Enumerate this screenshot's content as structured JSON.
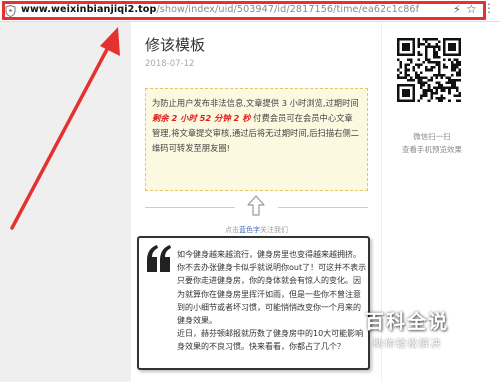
{
  "address_bar": {
    "url_host": "www.weixinbianjiqi2.top",
    "url_path": "/show/index/uid/503947/id/2817156/time/ea62c1c86f",
    "icons": [
      "security-icon",
      "bolt-icon",
      "star-icon",
      "menu-icon"
    ]
  },
  "article": {
    "title": "修该模板",
    "date": "2018-07-12",
    "notice": {
      "line1": "为防止用户发布非法信息,文章提供 3 小时浏览,过期时间",
      "countdown": "剩余 2 小时 52 分钟 2 秒",
      "line2": "付费会员可在会员中心文章管理,将文章提交审核,通过后将无过期时间,后扫描右侧二维码可转发至朋友圈!"
    },
    "divider_caption": {
      "part1": "点击",
      "highlight": "蓝色字",
      "part2": "关注我们"
    },
    "quote": {
      "para1": "如今健身越来越流行，健身房里也变得越来越拥挤。你不去办张健身卡似乎就说明你out了！可这并不表示只要你走进健身房，你的身体就会有惊人的变化。因为就算你在健身房里挥汗如雨，但是一些你不曾注意到的小细节或者坏习惯，可能悄悄改变你一个月来的健身效果。",
      "para2": "近日，赫芬顿邮报就历数了健身房中的10大可能影响身效果的不良习惯。快来看看，你都占了几个？"
    }
  },
  "side_panel": {
    "scan_label": "微信扫一扫",
    "preview_label": "查看手机预览效果"
  },
  "watermark": {
    "title": "百科全说",
    "subtitle": "助你轻松解决"
  },
  "colors": {
    "highlight_red": "#e5312f",
    "countdown_red": "#e02020",
    "notice_bg": "#fdf8e0",
    "link_blue": "#4a6fb5"
  }
}
